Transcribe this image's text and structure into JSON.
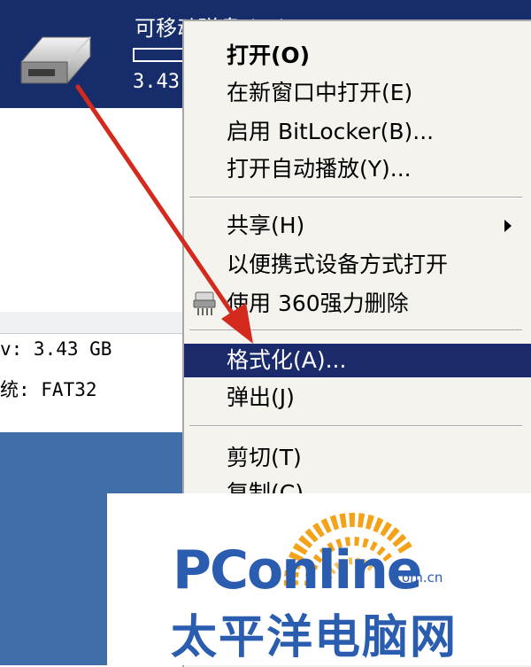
{
  "drive": {
    "name": "可移动磁盘 (H:)",
    "size_short": "3.43",
    "icon": "removable-drive-icon"
  },
  "details": {
    "capacity_line": "v: 3.43 GB",
    "filesystem_line": "统: FAT32"
  },
  "context_menu": {
    "items": [
      {
        "label": "打开(O)",
        "bold": true
      },
      {
        "label": "在新窗口中打开(E)"
      },
      {
        "label": "启用 BitLocker(B)..."
      },
      {
        "label": "打开自动播放(Y)..."
      },
      {
        "label": "共享(H)",
        "has_submenu": true
      },
      {
        "label": "以便携式设备方式打开"
      },
      {
        "label": "使用 360强力删除",
        "icon": "shredder-icon"
      },
      {
        "label": "格式化(A)...",
        "highlighted": true
      },
      {
        "label": "弹出(J)"
      },
      {
        "label": "剪切(T)"
      },
      {
        "label": "复制(C)"
      }
    ]
  },
  "watermark": {
    "logo_text": "PConline",
    "domain": ".com.cn",
    "chinese": "太平洋电脑网"
  },
  "colors": {
    "selection_blue": "#1a2a6b",
    "drive_panel": "#162c6b",
    "arrow_red": "#d42a1e",
    "watermark_blue": "#2a5db0",
    "watermark_orange": "#f3a21a"
  }
}
